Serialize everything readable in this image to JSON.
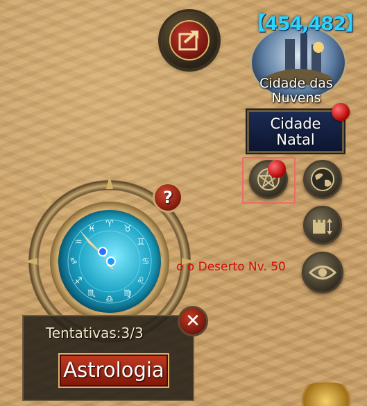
{
  "city": {
    "power": "【454,482】",
    "name": "Cidade das Nuvens"
  },
  "home_button": {
    "label": "Cidade Natal"
  },
  "help": {
    "label": "?"
  },
  "field_label": "o  o Deserto Nv. 50",
  "astrology_panel": {
    "attempts": "Tentativas:3/3",
    "button_label": "Astrologia",
    "close_label": "✕"
  },
  "icons": [
    "share-icon",
    "pentagram-icon",
    "globe-icon",
    "castle-move-icon",
    "eye-icon",
    "question-icon",
    "close-icon"
  ],
  "colors": {
    "accent_red": "#c23b22",
    "power_cyan": "#2ad4ff",
    "highlight_frame": "#ef6b6b",
    "field_label_red": "#d20d0d"
  }
}
